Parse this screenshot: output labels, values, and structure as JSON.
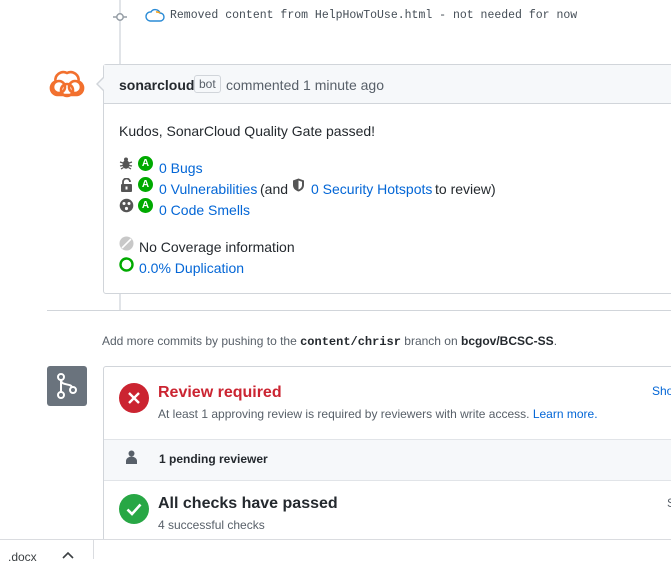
{
  "commit": {
    "message": "Removed content from HelpHowToUse.html - not needed for now"
  },
  "comment": {
    "author": "sonarcloud",
    "badge": "bot",
    "action": "commented 1 minute ago",
    "headline": "Kudos, SonarCloud Quality Gate passed!",
    "grade": "A",
    "bugs": "0 Bugs",
    "vulnerabilities": "0 Vulnerabilities",
    "and_text": "(and",
    "hotspots": "0 Security Hotspots",
    "to_review": "to review)",
    "code_smells": "0 Code Smells",
    "coverage": "No Coverage information",
    "duplication": "0.0% Duplication"
  },
  "info": {
    "prefix": "Add more commits by pushing to the",
    "branch": "content/chrisr",
    "middle": "branch on",
    "repo": "bcgov/BCSC-SS",
    "suffix": "."
  },
  "merge": {
    "review_title": "Review required",
    "review_sub": "At least 1 approving review is required by reviewers with write access.",
    "learn_more": "Learn more.",
    "show_fragment": "Sho",
    "pending": "1 pending reviewer",
    "checks_title": "All checks have passed",
    "checks_sub": "4 successful checks",
    "s_fragment": "S"
  },
  "download_bar": {
    "file": ".docx"
  },
  "colors": {
    "link": "#0366d6",
    "sonar_orange": "#f2702e",
    "grade_green": "#00aa00",
    "error_red": "#cb2431",
    "success_green": "#28a745"
  }
}
